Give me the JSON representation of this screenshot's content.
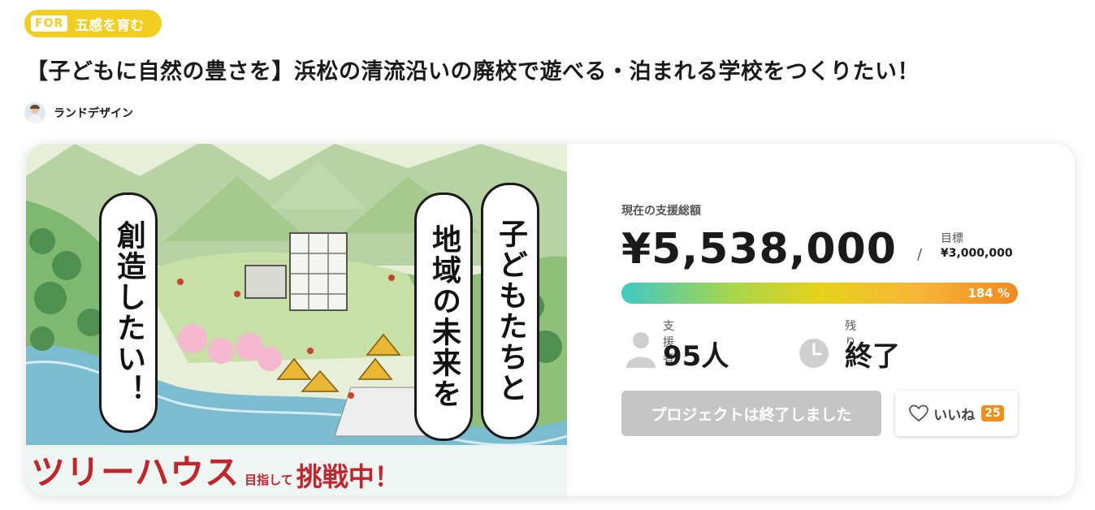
{
  "category": {
    "prefix": "FOR",
    "label": "五感を育む"
  },
  "project": {
    "title": "【子どもに自然の豊さを】浜松の清流沿いの廃校で遊べる・泊まれる学校をつくりたい！",
    "owner": "ランドデザイン"
  },
  "hero": {
    "vertical_left": "創造したい！",
    "vertical_right_1": "子どもたちと",
    "vertical_right_2": "地域の未来を",
    "banner_big": "ツリーハウス",
    "banner_small": "目指して",
    "banner_mid": "挑戦中！"
  },
  "funding": {
    "total_label": "現在の支援総額",
    "total_amount": "¥5,538,000",
    "slash": "/",
    "goal_label": "目標",
    "goal_amount": "¥3,000,000",
    "percent_text": "184 %",
    "percent": 184
  },
  "stats": {
    "supporters_label": "支援者",
    "supporters_value": "95人",
    "remaining_label": "残り",
    "remaining_value": "終了"
  },
  "actions": {
    "ended_label": "プロジェクトは終了しました",
    "like_label": "いいね",
    "like_count": "25"
  },
  "icons": {
    "supporters": "person-icon",
    "remaining": "clock-icon",
    "like": "heart-outline-icon"
  },
  "colors": {
    "tag": "#f2cf1f",
    "banner_red": "#c4242a",
    "like_badge": "#f28f1a",
    "disabled_button": "#c5c5c5"
  }
}
